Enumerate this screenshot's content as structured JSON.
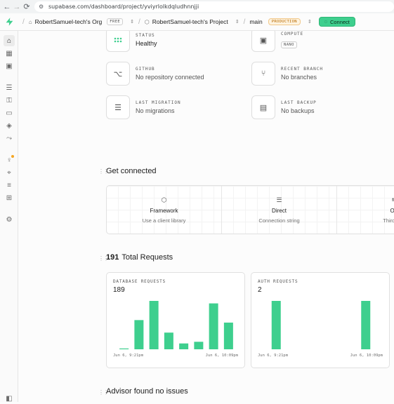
{
  "browser": {
    "url": "supabase.com/dashboard/project/yviyrlolkdqludhnnjji"
  },
  "topbar": {
    "org_name": "RobertSamuel-tech's Org",
    "org_badge": "FREE",
    "project_name": "RobertSamuel-tech's Project",
    "branch_name": "main",
    "branch_badge": "PRODUCTION",
    "connect_label": "Connect"
  },
  "stats": {
    "status": {
      "label": "STATUS",
      "value": "Healthy"
    },
    "compute": {
      "label": "COMPUTE",
      "value": "NANO"
    },
    "github": {
      "label": "GITHUB",
      "value": "No repository connected"
    },
    "recent_branch": {
      "label": "RECENT BRANCH",
      "value": "No branches"
    },
    "last_migration": {
      "label": "LAST MIGRATION",
      "value": "No migrations"
    },
    "last_backup": {
      "label": "LAST BACKUP",
      "value": "No backups"
    }
  },
  "get_connected": {
    "title": "Get connected",
    "cards": [
      {
        "title": "Framework",
        "subtitle": "Use a client library"
      },
      {
        "title": "Direct",
        "subtitle": "Connection string"
      },
      {
        "title": "OR",
        "subtitle": "Third-part"
      }
    ]
  },
  "requests": {
    "count": "191",
    "title": "Total Requests"
  },
  "advisor": {
    "title": "Advisor found no issues"
  },
  "colors": {
    "accent": "#3ecf8e",
    "bar": "#3ecf8e"
  },
  "chart_data": [
    {
      "type": "bar",
      "title": "DATABASE REQUESTS",
      "total": "189",
      "values": [
        1,
        35,
        58,
        20,
        7,
        9,
        55,
        32
      ],
      "x_start_label": "Jun 6, 9:21pm",
      "x_end_label": "Jun 6, 10:09pm"
    },
    {
      "type": "bar",
      "title": "AUTH REQUESTS",
      "total": "2",
      "values": [
        1,
        0,
        0,
        1
      ],
      "x_start_label": "Jun 6, 9:21pm",
      "x_end_label": "Jun 6, 10:09pm"
    }
  ]
}
